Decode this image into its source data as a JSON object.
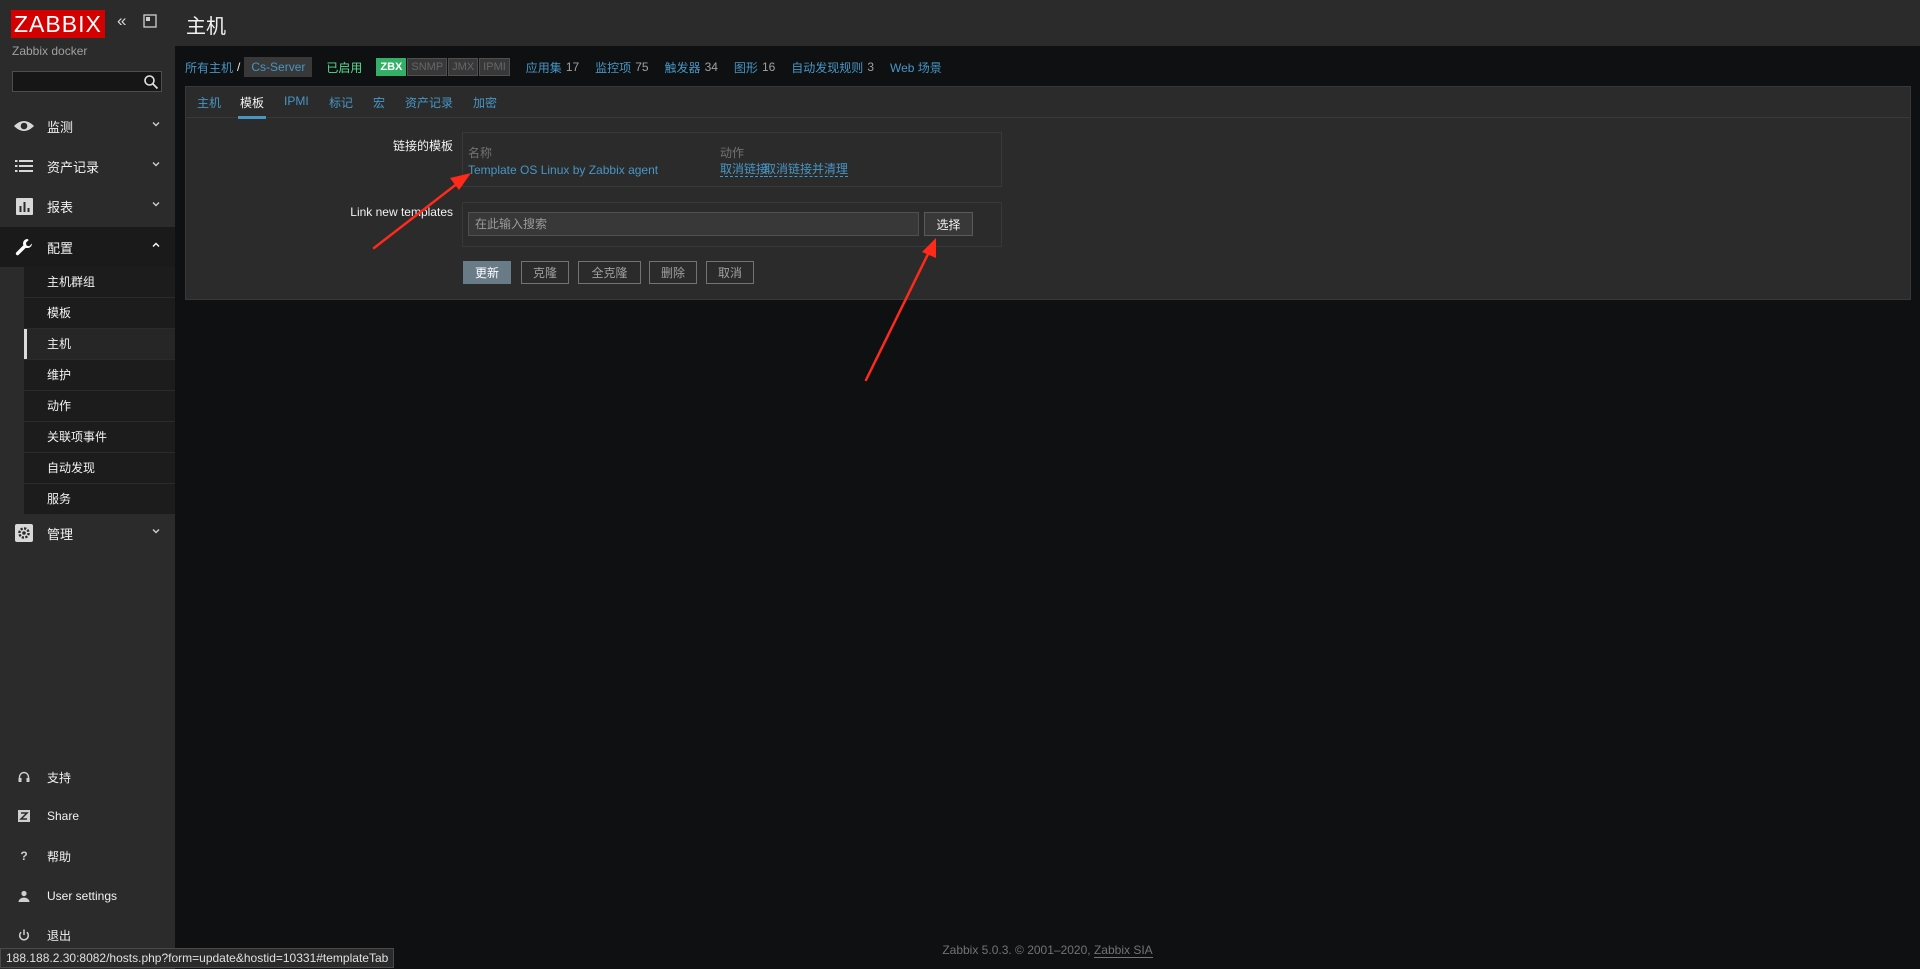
{
  "brand": {
    "logo": "ZABBIX",
    "server_name": "Zabbix docker"
  },
  "sidebar": {
    "search_value": "",
    "menu": [
      {
        "label": "监测",
        "icon": "eye-icon"
      },
      {
        "label": "资产记录",
        "icon": "list-icon"
      },
      {
        "label": "报表",
        "icon": "bar-chart-icon"
      },
      {
        "label": "配置",
        "icon": "wrench-icon"
      },
      {
        "label": "管理",
        "icon": "gear-icon"
      }
    ],
    "config_submenu": [
      "主机群组",
      "模板",
      "主机",
      "维护",
      "动作",
      "关联项事件",
      "自动发现",
      "服务"
    ],
    "active_submenu": "主机",
    "footer": [
      {
        "label": "支持",
        "icon": "headset-icon"
      },
      {
        "label": "Share",
        "icon": "share-icon"
      },
      {
        "label": "帮助",
        "icon": "help-icon"
      },
      {
        "label": "User settings",
        "icon": "user-icon"
      },
      {
        "label": "退出",
        "icon": "power-icon"
      }
    ]
  },
  "header": {
    "title": "主机"
  },
  "hostnav": {
    "all_hosts": "所有主机",
    "separator": "/",
    "host": "Cs-Server",
    "status": "已启用",
    "availability": [
      "ZBX",
      "SNMP",
      "JMX",
      "IPMI"
    ],
    "links": [
      {
        "label": "应用集",
        "count": "17"
      },
      {
        "label": "监控项",
        "count": "75"
      },
      {
        "label": "触发器",
        "count": "34"
      },
      {
        "label": "图形",
        "count": "16"
      },
      {
        "label": "自动发现规则",
        "count": "3"
      },
      {
        "label": "Web 场景",
        "count": ""
      }
    ]
  },
  "tabs": [
    "主机",
    "模板",
    "IPMI",
    "标记",
    "宏",
    "资产记录",
    "加密"
  ],
  "active_tab": "模板",
  "form": {
    "linked_label": "链接的模板",
    "col_name": "名称",
    "col_action": "动作",
    "linked_template": "Template OS Linux by Zabbix agent",
    "unlink": "取消链接",
    "unlink_clear": "取消链接并清理",
    "new_label": "Link new templates",
    "search_placeholder": "在此输入搜索",
    "select_button": "选择",
    "buttons": {
      "update": "更新",
      "clone": "克隆",
      "full_clone": "全克隆",
      "delete": "删除",
      "cancel": "取消"
    }
  },
  "footer": {
    "text": "Zabbix 5.0.3. © 2001–2020,",
    "company": "Zabbix SIA"
  },
  "statusbar": "188.188.2.30:8082/hosts.php?form=update&hostid=10331#templateTab",
  "colors": {
    "brand_red": "#d40000",
    "link_blue": "#4796c4",
    "enabled_green": "#59db8f",
    "zbx_green": "#34af67",
    "annotation_red": "#ff2a1a"
  }
}
